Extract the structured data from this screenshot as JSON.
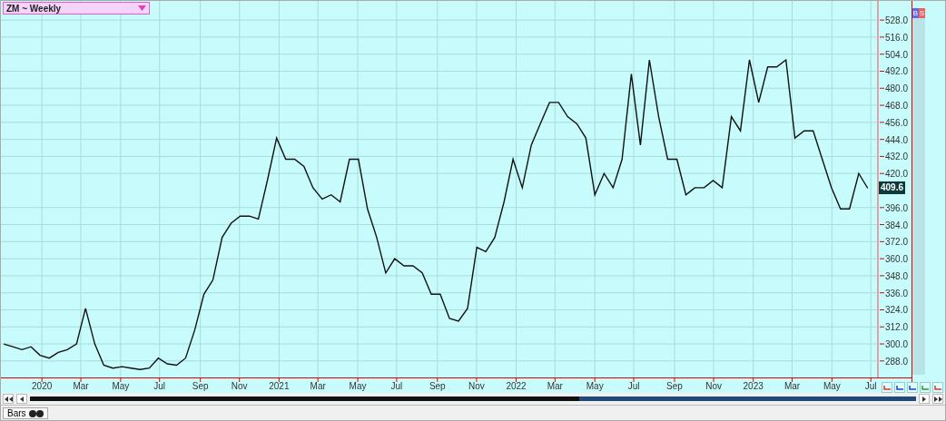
{
  "symbol_selector": {
    "label": "ZM ~ Weekly"
  },
  "side_buttons": [
    {
      "label": "B",
      "color": "#5a6cf0"
    },
    {
      "label": "S",
      "color": "#f06060"
    }
  ],
  "chart_data": {
    "type": "line",
    "grid": true,
    "xlim": [
      2019.827,
      2023.522
    ],
    "ylim": [
      276.4,
      541.5
    ],
    "x": [
      2019.839,
      2019.877,
      2019.916,
      2019.954,
      2019.992,
      2020.031,
      2020.069,
      2020.107,
      2020.146,
      2020.184,
      2020.223,
      2020.261,
      2020.299,
      2020.338,
      2020.376,
      2020.414,
      2020.453,
      2020.491,
      2020.529,
      2020.568,
      2020.606,
      2020.645,
      2020.683,
      2020.721,
      2020.76,
      2020.798,
      2020.836,
      2020.875,
      2020.913,
      2020.951,
      2020.99,
      2021.028,
      2021.066,
      2021.105,
      2021.143,
      2021.182,
      2021.22,
      2021.258,
      2021.297,
      2021.335,
      2021.373,
      2021.412,
      2021.45,
      2021.488,
      2021.527,
      2021.565,
      2021.604,
      2021.642,
      2021.68,
      2021.719,
      2021.757,
      2021.795,
      2021.834,
      2021.872,
      2021.91,
      2021.949,
      2021.987,
      2022.026,
      2022.064,
      2022.102,
      2022.141,
      2022.179,
      2022.217,
      2022.256,
      2022.294,
      2022.332,
      2022.371,
      2022.409,
      2022.447,
      2022.486,
      2022.524,
      2022.562,
      2022.601,
      2022.639,
      2022.678,
      2022.716,
      2022.754,
      2022.793,
      2022.831,
      2022.869,
      2022.908,
      2022.946,
      2022.984,
      2023.023,
      2023.061,
      2023.099,
      2023.138,
      2023.176,
      2023.215,
      2023.253,
      2023.291,
      2023.33,
      2023.368,
      2023.406,
      2023.445,
      2023.483
    ],
    "series": [
      {
        "color": "#111111",
        "values": [
          300,
          298,
          296,
          298,
          292,
          290,
          294,
          296,
          300,
          325,
          300,
          285,
          283,
          284,
          283,
          282,
          283,
          290,
          286,
          285,
          290,
          310,
          335,
          345,
          375,
          385,
          390,
          390,
          388,
          415,
          445,
          430,
          430,
          425,
          410,
          402,
          405,
          400,
          430,
          430,
          395,
          375,
          350,
          360,
          355,
          355,
          350,
          335,
          335,
          318,
          316,
          325,
          368,
          365,
          375,
          400,
          430,
          410,
          440,
          455,
          470,
          470,
          460,
          455,
          445,
          405,
          420,
          410,
          430,
          490,
          440,
          500,
          460,
          430,
          430,
          405,
          410,
          410,
          415,
          410,
          460,
          450,
          500,
          470,
          495,
          495,
          500,
          445,
          450,
          450,
          430,
          410,
          395,
          395,
          420,
          409.6
        ]
      }
    ],
    "yticks": [
      {
        "value": 288,
        "label": "288.0"
      },
      {
        "value": 300,
        "label": "300.0"
      },
      {
        "value": 312,
        "label": "312.0"
      },
      {
        "value": 324,
        "label": "324.0"
      },
      {
        "value": 336,
        "label": "336.0"
      },
      {
        "value": 348,
        "label": "348.0"
      },
      {
        "value": 360,
        "label": "360.0"
      },
      {
        "value": 372,
        "label": "372.0"
      },
      {
        "value": 384,
        "label": "384.0"
      },
      {
        "value": 396,
        "label": "396.0"
      },
      {
        "value": 420,
        "label": "420.0"
      },
      {
        "value": 432,
        "label": "432.0"
      },
      {
        "value": 444,
        "label": "444.0"
      },
      {
        "value": 456,
        "label": "456.0"
      },
      {
        "value": 468,
        "label": "468.0"
      },
      {
        "value": 480,
        "label": "480.0"
      },
      {
        "value": 492,
        "label": "492.0"
      },
      {
        "value": 504,
        "label": "504.0"
      },
      {
        "value": 516,
        "label": "516.0"
      },
      {
        "value": 528,
        "label": "528.0"
      }
    ],
    "xticks": [
      {
        "value": 2020,
        "label": "2020"
      },
      {
        "value": 2020.164,
        "label": "Mar"
      },
      {
        "value": 2020.332,
        "label": "May"
      },
      {
        "value": 2020.496,
        "label": "Jul"
      },
      {
        "value": 2020.668,
        "label": "Sep"
      },
      {
        "value": 2020.833,
        "label": "Nov"
      },
      {
        "value": 2021,
        "label": "2021"
      },
      {
        "value": 2021.164,
        "label": "Mar"
      },
      {
        "value": 2021.332,
        "label": "May"
      },
      {
        "value": 2021.496,
        "label": "Jul"
      },
      {
        "value": 2021.668,
        "label": "Sep"
      },
      {
        "value": 2021.833,
        "label": "Nov"
      },
      {
        "value": 2022,
        "label": "2022"
      },
      {
        "value": 2022.164,
        "label": "Mar"
      },
      {
        "value": 2022.332,
        "label": "May"
      },
      {
        "value": 2022.496,
        "label": "Jul"
      },
      {
        "value": 2022.668,
        "label": "Sep"
      },
      {
        "value": 2022.833,
        "label": "Nov"
      },
      {
        "value": 2023,
        "label": "2023"
      },
      {
        "value": 2023.164,
        "label": "Mar"
      },
      {
        "value": 2023.332,
        "label": "May"
      },
      {
        "value": 2023.496,
        "label": "Jul"
      }
    ]
  },
  "last_price": {
    "label": "409.6"
  },
  "scrollbar": {
    "level": 0.38
  },
  "bottom_tab": {
    "label": "Bars"
  }
}
